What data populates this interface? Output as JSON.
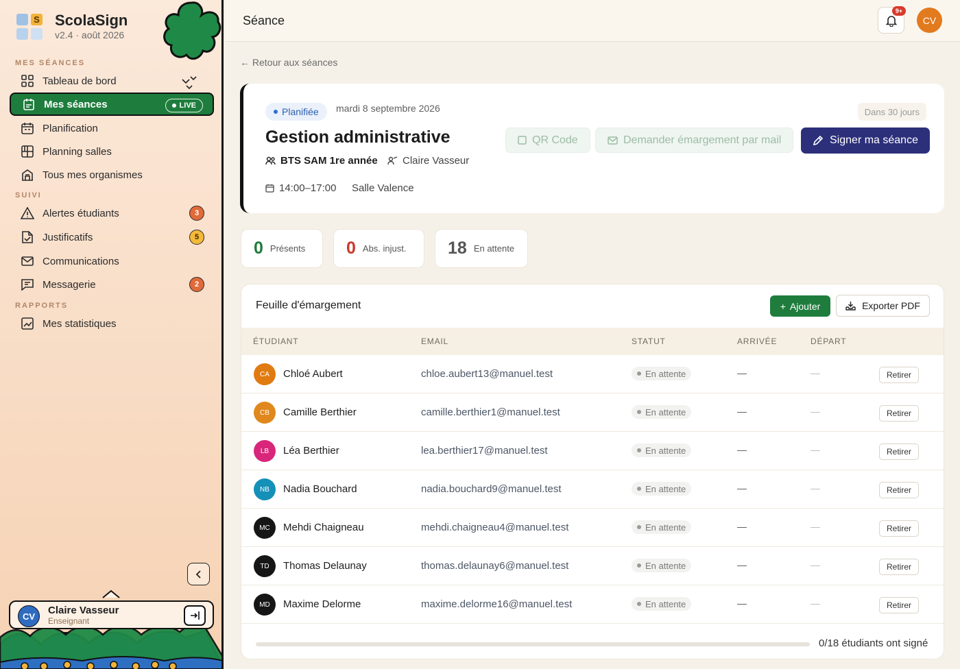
{
  "app": {
    "name": "ScolaSign",
    "version": "v2.4 · août 2026",
    "logo_letter": "S"
  },
  "sidebar": {
    "sections": {
      "mes_seances": "MES SÉANCES",
      "suivi": "SUIVI",
      "rapports": "RAPPORTS"
    },
    "items": [
      {
        "label": "Tableau de bord",
        "icon": "grid-icon"
      },
      {
        "label": "Mes séances",
        "icon": "clipboard-icon",
        "active": true,
        "badge": "LIVE"
      },
      {
        "label": "Planification",
        "icon": "calendar-icon"
      },
      {
        "label": "Planning salles",
        "icon": "rooms-grid-icon"
      },
      {
        "label": "Tous mes organismes",
        "icon": "building-icon"
      },
      {
        "label": "Alertes étudiants",
        "icon": "warning-icon",
        "count": "3"
      },
      {
        "label": "Justificatifs",
        "icon": "document-check-icon",
        "count": "5"
      },
      {
        "label": "Communications",
        "icon": "mail-icon"
      },
      {
        "label": "Messagerie",
        "icon": "chat-icon",
        "count": "2"
      },
      {
        "label": "Mes statistiques",
        "icon": "chart-icon"
      }
    ],
    "user": {
      "initials": "CV",
      "name": "Claire Vasseur",
      "role": "Enseignant"
    }
  },
  "topbar": {
    "title": "Séance",
    "notif_badge": "9+",
    "avatar_initials": "CV"
  },
  "back_link": "← Retour aux séances",
  "session": {
    "status": "Planifiée",
    "date": "mardi 8 septembre 2026",
    "countdown": "Dans 30 jours",
    "title": "Gestion administrative",
    "group": "BTS SAM 1re année",
    "teacher": "Claire Vasseur",
    "time": "14:00–17:00",
    "room": "Salle Valence",
    "actions": {
      "qr": "QR Code",
      "mail": "Demander émargement par mail",
      "sign": "Signer ma séance"
    }
  },
  "stats": [
    {
      "value": "0",
      "label": "Présents"
    },
    {
      "value": "0",
      "label": "Abs. injust."
    },
    {
      "value": "18",
      "label": "En attente"
    }
  ],
  "sheet": {
    "title": "Feuille d'émargement",
    "add_label": "Ajouter",
    "export_label": "Exporter PDF",
    "columns": [
      "ÉTUDIANT",
      "EMAIL",
      "STATUT",
      "ARRIVÉE",
      "DÉPART"
    ],
    "rows": [
      {
        "initials": "CA",
        "name": "Chloé Aubert",
        "email": "chloe.aubert13@manuel.test",
        "status": "En attente",
        "arrival": "—",
        "departure": "—",
        "action": "Retirer",
        "color": "#e07b12"
      },
      {
        "initials": "CB",
        "name": "Camille Berthier",
        "email": "camille.berthier1@manuel.test",
        "status": "En attente",
        "arrival": "—",
        "departure": "—",
        "action": "Retirer",
        "color": "#e0881d"
      },
      {
        "initials": "LB",
        "name": "Léa Berthier",
        "email": "lea.berthier17@manuel.test",
        "status": "En attente",
        "arrival": "—",
        "departure": "—",
        "action": "Retirer",
        "color": "#d8267a"
      },
      {
        "initials": "NB",
        "name": "Nadia Bouchard",
        "email": "nadia.bouchard9@manuel.test",
        "status": "En attente",
        "arrival": "—",
        "departure": "—",
        "action": "Retirer",
        "color": "#1590b8"
      },
      {
        "initials": "MC",
        "name": "Mehdi Chaigneau",
        "email": "mehdi.chaigneau4@manuel.test",
        "status": "En attente",
        "arrival": "—",
        "departure": "—",
        "action": "Retirer",
        "color": "#161616"
      },
      {
        "initials": "TD",
        "name": "Thomas Delaunay",
        "email": "thomas.delaunay6@manuel.test",
        "status": "En attente",
        "arrival": "—",
        "departure": "—",
        "action": "Retirer",
        "color": "#161616"
      },
      {
        "initials": "MD",
        "name": "Maxime Delorme",
        "email": "maxime.delorme16@manuel.test",
        "status": "En attente",
        "arrival": "—",
        "departure": "—",
        "action": "Retirer",
        "color": "#161616"
      }
    ],
    "progress_text": "0/18 étudiants ont signé",
    "progress_fraction": 0
  },
  "colors": {
    "brand_green": "#1e7d3d",
    "primary": "#2c2f7a",
    "accent_orange": "#e27a1e"
  }
}
